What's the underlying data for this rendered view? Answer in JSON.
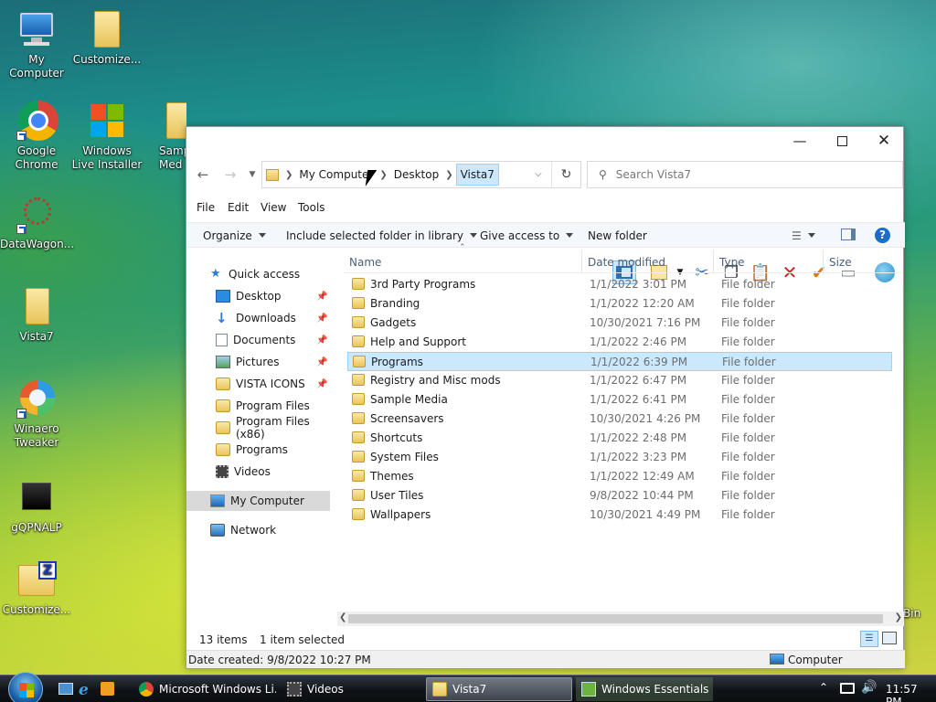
{
  "desktop": {
    "icons": [
      {
        "label": "My Computer"
      },
      {
        "label": "Customize..."
      },
      {
        "label": "Google Chrome"
      },
      {
        "label": "Windows Live Installer"
      },
      {
        "label": "Samp Med"
      },
      {
        "label": "DataWagon..."
      },
      {
        "label": "Vista7"
      },
      {
        "label": "Winaero Tweaker"
      },
      {
        "label": "gQPNALP"
      },
      {
        "label": "Customize..."
      },
      {
        "label": "Bin"
      }
    ]
  },
  "window": {
    "breadcrumbs": [
      "My Computer",
      "Desktop",
      "Vista7"
    ],
    "search_placeholder": "Search Vista7",
    "menu": [
      "File",
      "Edit",
      "View",
      "Tools"
    ],
    "commands": {
      "organize": "Organize",
      "include": "Include selected folder in library",
      "give_access": "Give access to",
      "new_folder": "New folder"
    },
    "nav": {
      "quick_access": "Quick access",
      "items": [
        "Desktop",
        "Downloads",
        "Documents",
        "Pictures",
        "VISTA ICONS",
        "Program Files",
        "Program Files (x86)",
        "Programs",
        "Videos"
      ],
      "my_computer": "My Computer",
      "network": "Network"
    },
    "columns": [
      "Name",
      "Date modified",
      "Type",
      "Size"
    ],
    "files": [
      {
        "name": "3rd Party Programs",
        "date": "1/1/2022 3:01 PM",
        "type": "File folder"
      },
      {
        "name": "Branding",
        "date": "1/1/2022 12:20 AM",
        "type": "File folder"
      },
      {
        "name": "Gadgets",
        "date": "10/30/2021 7:16 PM",
        "type": "File folder"
      },
      {
        "name": "Help and Support",
        "date": "1/1/2022 2:46 PM",
        "type": "File folder"
      },
      {
        "name": "Programs",
        "date": "1/1/2022 6:39 PM",
        "type": "File folder",
        "selected": true
      },
      {
        "name": "Registry and Misc mods",
        "date": "1/1/2022 6:47 PM",
        "type": "File folder"
      },
      {
        "name": "Sample Media",
        "date": "1/1/2022 6:41 PM",
        "type": "File folder"
      },
      {
        "name": "Screensavers",
        "date": "10/30/2021 4:26 PM",
        "type": "File folder"
      },
      {
        "name": "Shortcuts",
        "date": "1/1/2022 2:48 PM",
        "type": "File folder"
      },
      {
        "name": "System Files",
        "date": "1/1/2022 3:23 PM",
        "type": "File folder"
      },
      {
        "name": "Themes",
        "date": "1/1/2022 12:49 AM",
        "type": "File folder"
      },
      {
        "name": "User Tiles",
        "date": "9/8/2022 10:44 PM",
        "type": "File folder"
      },
      {
        "name": "Wallpapers",
        "date": "10/30/2021 4:49 PM",
        "type": "File folder"
      }
    ],
    "status": {
      "count": "13 items",
      "selected": "1 item selected"
    },
    "details": {
      "date_created": "Date created: 9/8/2022 10:27 PM",
      "location": "Computer"
    }
  },
  "taskbar": {
    "items": [
      "Microsoft Windows Li...",
      "Videos",
      "Vista7",
      "Windows Essentials 2..."
    ],
    "clock": "11:57 PM"
  },
  "colors": {
    "selection": "#cce8ff",
    "taskbar": "#101418",
    "accent": "#0078d7"
  }
}
